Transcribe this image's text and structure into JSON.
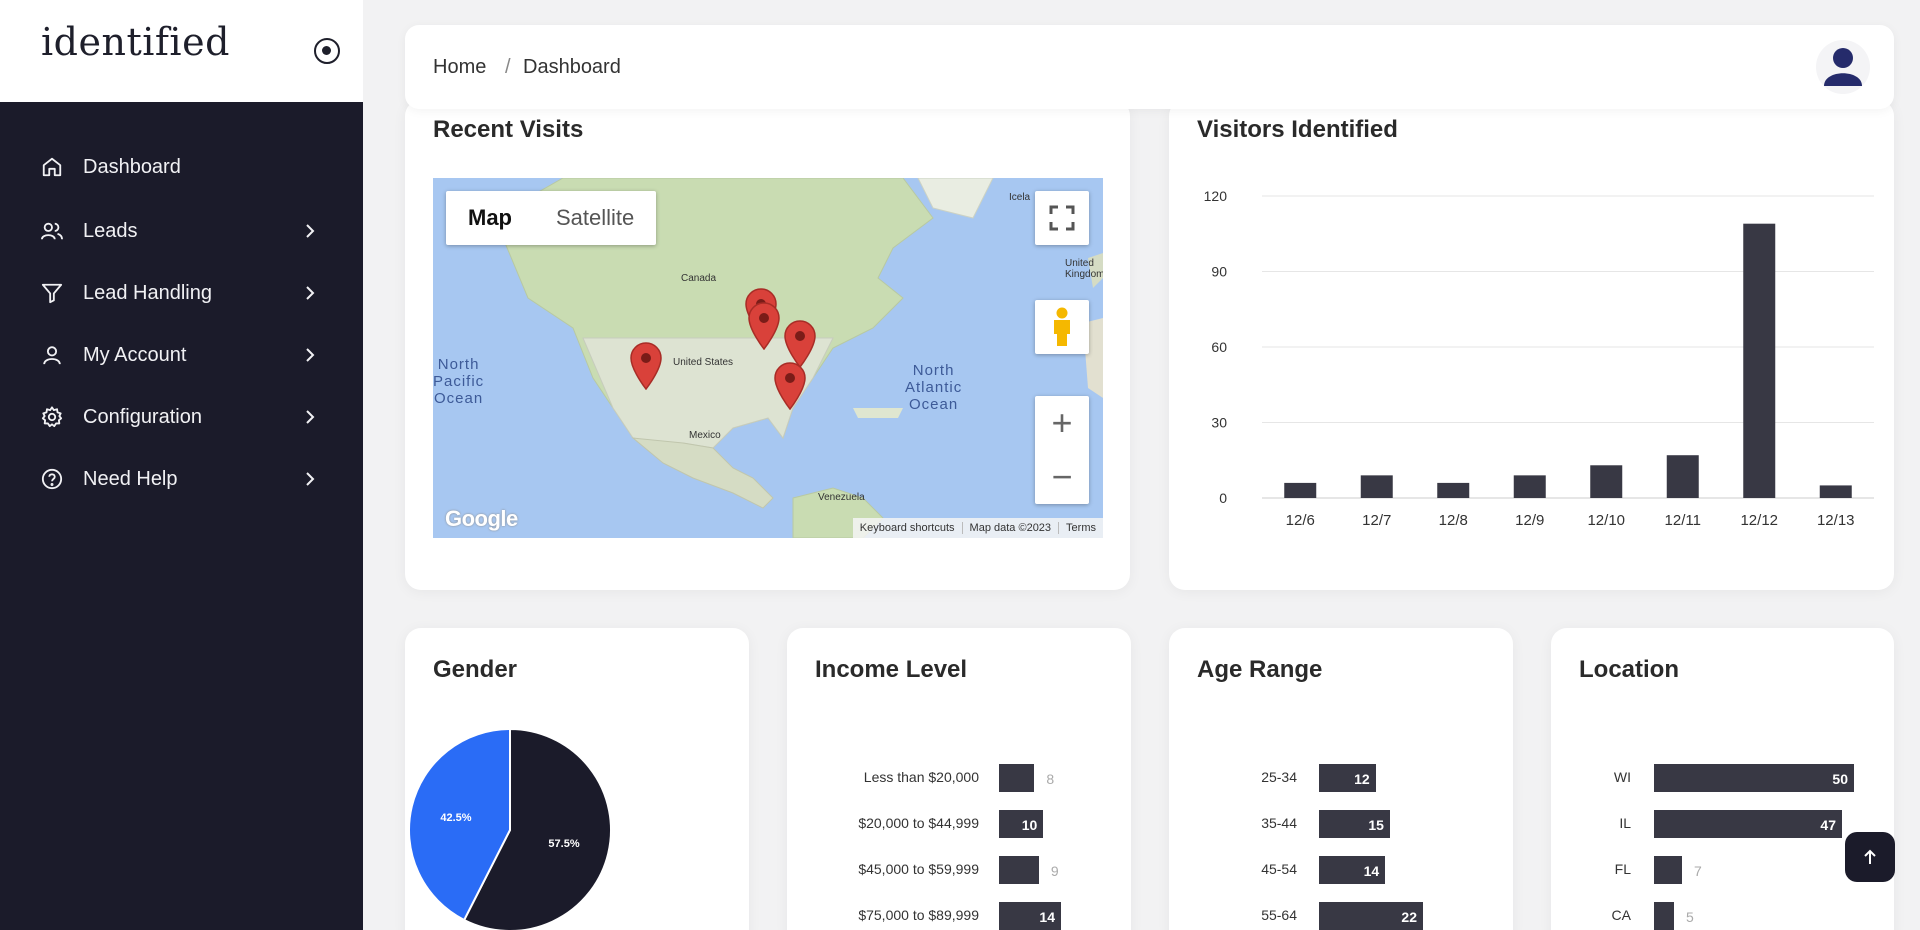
{
  "brand": {
    "name": "identified"
  },
  "sidebar": {
    "items": [
      {
        "label": "Dashboard",
        "icon": "home-icon",
        "has_children": false
      },
      {
        "label": "Leads",
        "icon": "users-icon",
        "has_children": true
      },
      {
        "label": "Lead Handling",
        "icon": "filter-icon",
        "has_children": true
      },
      {
        "label": "My Account",
        "icon": "user-icon",
        "has_children": true
      },
      {
        "label": "Configuration",
        "icon": "gear-icon",
        "has_children": true
      },
      {
        "label": "Need Help",
        "icon": "help-circle-icon",
        "has_children": true
      }
    ]
  },
  "header": {
    "breadcrumb": {
      "home": "Home",
      "separator": "/",
      "current": "Dashboard"
    }
  },
  "recent_visits": {
    "title": "Recent Visits",
    "map": {
      "type_options": [
        "Map",
        "Satellite"
      ],
      "selected_type": "Map",
      "labels": {
        "canada": "Canada",
        "united_states": "United States",
        "mexico": "Mexico",
        "venezuela": "Venezuela",
        "iceland": "Icela",
        "united_kingdom": "United\nKingdom",
        "north_pacific": "North\nPacific\nOcean",
        "north_atlantic": "North\nAtlantic\nOcean"
      },
      "logo": "Google",
      "footer": [
        "Keyboard shortcuts",
        "Map data ©2023",
        "Terms"
      ],
      "zoom_in": "+",
      "zoom_out": "−"
    }
  },
  "visitors_identified": {
    "title": "Visitors Identified"
  },
  "gender": {
    "title": "Gender"
  },
  "income": {
    "title": "Income Level"
  },
  "age": {
    "title": "Age Range"
  },
  "location": {
    "title": "Location"
  },
  "colors": {
    "sidebar_bg": "#1b1b2a",
    "bar": "#383844",
    "pie_blue": "#2a6cf6",
    "pie_dark": "#1b1b2a",
    "pin": "#d9413a"
  },
  "chart_data": [
    {
      "type": "bar",
      "title": "Visitors Identified",
      "categories": [
        "12/6",
        "12/7",
        "12/8",
        "12/9",
        "12/10",
        "12/11",
        "12/12",
        "12/13"
      ],
      "values": [
        6,
        9,
        6,
        9,
        13,
        17,
        109,
        5
      ],
      "ylim": [
        0,
        120
      ],
      "yticks": [
        0,
        30,
        60,
        90,
        120
      ],
      "grid": true
    },
    {
      "type": "pie",
      "title": "Gender",
      "slices": [
        {
          "label": "42.5%",
          "value": 42.5,
          "color": "#2a6cf6"
        },
        {
          "label": "57.5%",
          "value": 57.5,
          "color": "#1b1b2a"
        }
      ]
    },
    {
      "type": "bar",
      "orientation": "horizontal",
      "title": "Income Level",
      "categories": [
        "Less than $20,000",
        "$20,000 to $44,999",
        "$45,000 to $59,999",
        "$75,000 to $89,999"
      ],
      "values": [
        8,
        10,
        9,
        14
      ]
    },
    {
      "type": "bar",
      "orientation": "horizontal",
      "title": "Age Range",
      "categories": [
        "25-34",
        "35-44",
        "45-54",
        "55-64"
      ],
      "values": [
        12,
        15,
        14,
        22
      ]
    },
    {
      "type": "bar",
      "orientation": "horizontal",
      "title": "Location",
      "categories": [
        "WI",
        "IL",
        "FL",
        "CA"
      ],
      "values": [
        50,
        47,
        7,
        5
      ]
    }
  ]
}
